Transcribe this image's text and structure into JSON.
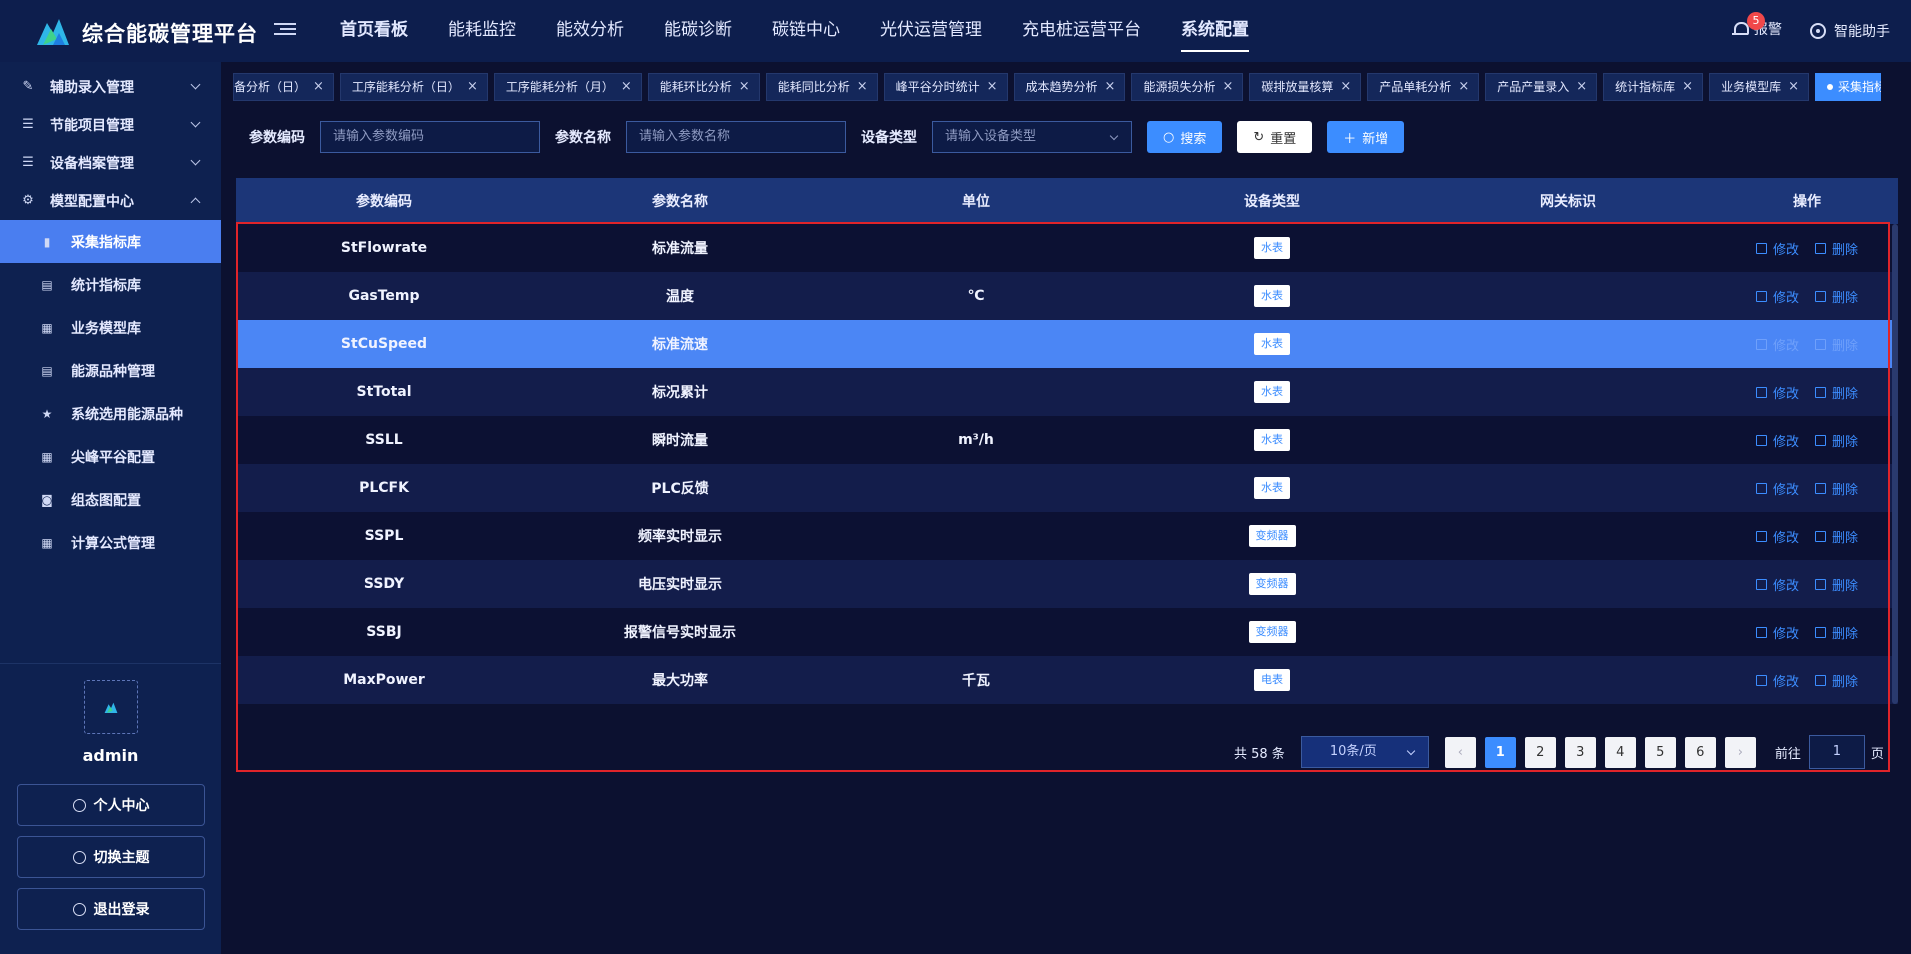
{
  "app": {
    "title": "综合能碳管理平台"
  },
  "nav": [
    "首页看板",
    "能耗监控",
    "能效分析",
    "能碳诊断",
    "碳链中心",
    "光伏运营管理",
    "充电桩运营平台",
    "系统配置"
  ],
  "header": {
    "alarm_label": "报警",
    "alarm_count": "5",
    "assistant_label": "智能助手"
  },
  "sidebar": {
    "groups": [
      {
        "label": "辅助录入管理"
      },
      {
        "label": "节能项目管理"
      },
      {
        "label": "设备档案管理"
      },
      {
        "label": "模型配置中心"
      }
    ],
    "items": [
      {
        "label": "采集指标库",
        "icon": "bar-chart-icon"
      },
      {
        "label": "统计指标库",
        "icon": "document-icon"
      },
      {
        "label": "业务模型库",
        "icon": "table-icon"
      },
      {
        "label": "能源品种管理",
        "icon": "document-icon"
      },
      {
        "label": "系统选用能源品种",
        "icon": "star-icon"
      },
      {
        "label": "尖峰平谷配置",
        "icon": "table-icon"
      },
      {
        "label": "组态图配置",
        "icon": "bus-icon"
      },
      {
        "label": "计算公式管理",
        "icon": "table-icon"
      }
    ],
    "username": "admin",
    "buttons": [
      "个人中心",
      "切换主题",
      "退出登录"
    ]
  },
  "tags": [
    {
      "label": "备分析（日）"
    },
    {
      "label": "工序能耗分析（日）"
    },
    {
      "label": "工序能耗分析（月）"
    },
    {
      "label": "能耗环比分析"
    },
    {
      "label": "能耗同比分析"
    },
    {
      "label": "峰平谷分时统计"
    },
    {
      "label": "成本趋势分析"
    },
    {
      "label": "能源损失分析"
    },
    {
      "label": "碳排放量核算"
    },
    {
      "label": "产品单耗分析"
    },
    {
      "label": "产品产量录入"
    },
    {
      "label": "统计指标库"
    },
    {
      "label": "业务模型库"
    },
    {
      "label": "采集指标库"
    }
  ],
  "search": {
    "code_label": "参数编码",
    "code_placeholder": "请输入参数编码",
    "name_label": "参数名称",
    "name_placeholder": "请输入参数名称",
    "type_label": "设备类型",
    "type_placeholder": "请输入设备类型",
    "search_btn": "搜索",
    "reset_btn": "重置",
    "add_btn": "新增"
  },
  "table": {
    "columns": [
      "参数编码",
      "参数名称",
      "单位",
      "设备类型",
      "网关标识",
      "操作"
    ],
    "edit_label": "修改",
    "delete_label": "删除",
    "rows": [
      {
        "code": "StFlowrate",
        "name": "标准流量",
        "unit": "",
        "type": "水表",
        "gateway": ""
      },
      {
        "code": "GasTemp",
        "name": "温度",
        "unit": "℃",
        "type": "水表",
        "gateway": ""
      },
      {
        "code": "StCuSpeed",
        "name": "标准流速",
        "unit": "",
        "type": "水表",
        "gateway": ""
      },
      {
        "code": "StTotal",
        "name": "标况累计",
        "unit": "",
        "type": "水表",
        "gateway": ""
      },
      {
        "code": "SSLL",
        "name": "瞬时流量",
        "unit": "m³/h",
        "type": "水表",
        "gateway": ""
      },
      {
        "code": "PLCFK",
        "name": "PLC反馈",
        "unit": "",
        "type": "水表",
        "gateway": ""
      },
      {
        "code": "SSPL",
        "name": "频率实时显示",
        "unit": "",
        "type": "变频器",
        "gateway": ""
      },
      {
        "code": "SSDY",
        "name": "电压实时显示",
        "unit": "",
        "type": "变频器",
        "gateway": ""
      },
      {
        "code": "SSBJ",
        "name": "报警信号实时显示",
        "unit": "",
        "type": "变频器",
        "gateway": ""
      },
      {
        "code": "MaxPower",
        "name": "最大功率",
        "unit": "千瓦",
        "type": "电表",
        "gateway": ""
      }
    ]
  },
  "pagination": {
    "total": "共 58 条",
    "page_size": "10条/页",
    "pages": [
      "1",
      "2",
      "3",
      "4",
      "5",
      "6"
    ],
    "prev": "‹",
    "next": "›",
    "goto_label": "前往",
    "goto_value": "1",
    "page_unit": "页"
  }
}
